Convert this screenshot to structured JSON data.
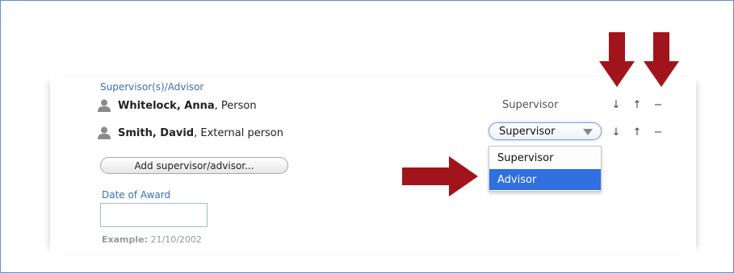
{
  "supervisors": {
    "section_label": "Supervisor(s)/Advisor",
    "rows": [
      {
        "name": "Whitelock, Anna",
        "type": ", Person",
        "role": "Supervisor"
      },
      {
        "name": "Smith, David",
        "type": ", External person",
        "role": "Supervisor"
      }
    ],
    "controls": {
      "down": "↓",
      "up": "↑",
      "remove": "−"
    },
    "dropdown_options": [
      {
        "label": "Supervisor",
        "selected": false
      },
      {
        "label": "Advisor",
        "selected": true
      }
    ],
    "add_button_label": "Add supervisor/advisor..."
  },
  "date_of_award": {
    "label": "Date of Award",
    "value": "",
    "example_key": "Example:",
    "example_value": " 21/10/2002"
  },
  "colors": {
    "link_blue": "#3a6fae",
    "highlight_blue": "#2f6fe0",
    "annotation_arrow": "#a2141c"
  },
  "icons": [
    "person-icon",
    "arrow-down-icon",
    "arrow-up-icon",
    "remove-icon",
    "chevron-down-icon"
  ]
}
